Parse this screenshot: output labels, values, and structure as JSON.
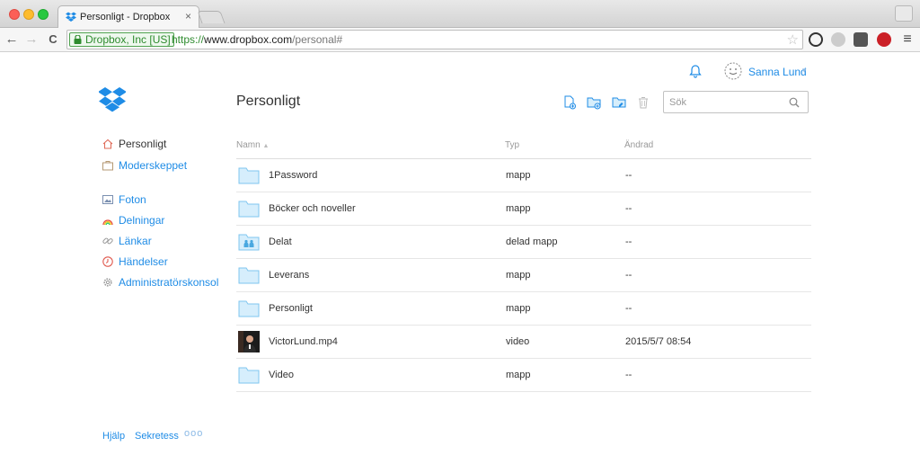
{
  "browser": {
    "tab_title": "Personligt - Dropbox",
    "tab_close": "×",
    "ev_cert": "Dropbox, Inc [US]",
    "url_scheme": "https://",
    "url_host": "www.dropbox.com",
    "url_path": "/personal#",
    "back_icon": "←",
    "forward_icon": "→",
    "reload_icon": "C",
    "star_icon": "☆",
    "menu_icon": "≡"
  },
  "header": {
    "user_name": "Sanna Lund",
    "user_caret": "▾"
  },
  "main": {
    "title": "Personligt",
    "search_placeholder": "Sök"
  },
  "sidebar": {
    "items": [
      {
        "label": "Personligt",
        "icon": "home-icon",
        "active": true
      },
      {
        "label": "Moderskeppet",
        "icon": "briefcase-icon",
        "active": false
      },
      {
        "label": "Foton",
        "icon": "photos-icon",
        "active": false
      },
      {
        "label": "Delningar",
        "icon": "rainbow-icon",
        "active": false
      },
      {
        "label": "Länkar",
        "icon": "link-icon",
        "active": false
      },
      {
        "label": "Händelser",
        "icon": "clock-icon",
        "active": false
      },
      {
        "label": "Administratörskonsol",
        "icon": "gear-icon",
        "active": false
      }
    ]
  },
  "table": {
    "columns": [
      "Namn",
      "Typ",
      "Ändrad"
    ],
    "sort_indicator": "▲",
    "rows": [
      {
        "name": "1Password",
        "type": "mapp",
        "modified": "--",
        "icon": "folder-icon"
      },
      {
        "name": "Böcker och noveller",
        "type": "mapp",
        "modified": "--",
        "icon": "folder-icon"
      },
      {
        "name": "Delat",
        "type": "delad mapp",
        "modified": "--",
        "icon": "shared-folder-icon"
      },
      {
        "name": "Leverans",
        "type": "mapp",
        "modified": "--",
        "icon": "folder-icon"
      },
      {
        "name": "Personligt",
        "type": "mapp",
        "modified": "--",
        "icon": "folder-icon"
      },
      {
        "name": "VictorLund.mp4",
        "type": "video",
        "modified": "2015/5/7 08:54",
        "icon": "video-thumbnail"
      },
      {
        "name": "Video",
        "type": "mapp",
        "modified": "--",
        "icon": "folder-icon"
      }
    ]
  },
  "footer": {
    "help": "Hjälp",
    "privacy": "Sekretess",
    "more": "ooo"
  },
  "colors": {
    "accent": "#1f8ce6",
    "folder": "#7fc6ef",
    "secure_green": "#2e8b2e"
  }
}
